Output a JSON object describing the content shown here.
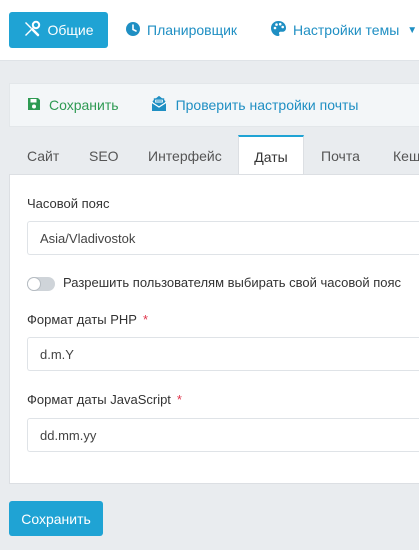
{
  "topnav": {
    "general_label": "Общие",
    "planner_label": "Планировщик",
    "theme_label": "Настройки темы"
  },
  "toolbar": {
    "save_label": "Сохранить",
    "check_mail_label": "Проверить настройки почты"
  },
  "tabs": [
    {
      "label": "Сайт",
      "active": false
    },
    {
      "label": "SEO",
      "active": false
    },
    {
      "label": "Интерфейс",
      "active": false
    },
    {
      "label": "Даты",
      "active": true
    },
    {
      "label": "Почта",
      "active": false
    },
    {
      "label": "Кеш",
      "active": false
    }
  ],
  "form": {
    "timezone": {
      "label": "Часовой пояс",
      "value": "Asia/Vladivostok"
    },
    "allow_user_tz": {
      "label": "Разрешить пользователям выбирать свой часовой пояс",
      "enabled": false
    },
    "php_date": {
      "label": "Формат даты PHP",
      "required_mark": "*",
      "value": "d.m.Y"
    },
    "js_date": {
      "label": "Формат даты JavaScript",
      "required_mark": "*",
      "value": "dd.mm.yy"
    }
  },
  "footer": {
    "save_label": "Сохранить"
  },
  "colors": {
    "accent": "#1fa3d4",
    "link": "#1f8fc3",
    "success": "#2e9a53",
    "required": "#e0344b"
  },
  "icons": {
    "general": "tools-icon",
    "planner": "clock-icon",
    "theme": "palette-icon",
    "save": "floppy-disk-icon",
    "check_mail": "mail-check-icon"
  }
}
